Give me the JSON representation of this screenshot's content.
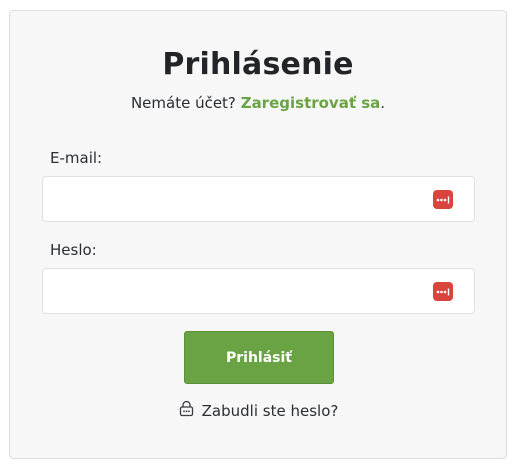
{
  "login": {
    "title": "Prihlásenie",
    "no_account_text": "Nemáte účet?",
    "register_link": "Zaregistrovať sa",
    "period": ".",
    "email_label": "E-mail:",
    "email_value": "",
    "password_label": "Heslo:",
    "password_value": "",
    "submit_label": "Prihlásiť",
    "forgot_label": "Zabudli ste heslo?"
  },
  "icons": {
    "password_manager": "password-manager-icon",
    "forgot": "lock-icon"
  },
  "colors": {
    "accent": "#6aa343",
    "password_icon": "#d9453c",
    "card_bg": "#f7f7f7",
    "text": "#222428"
  }
}
